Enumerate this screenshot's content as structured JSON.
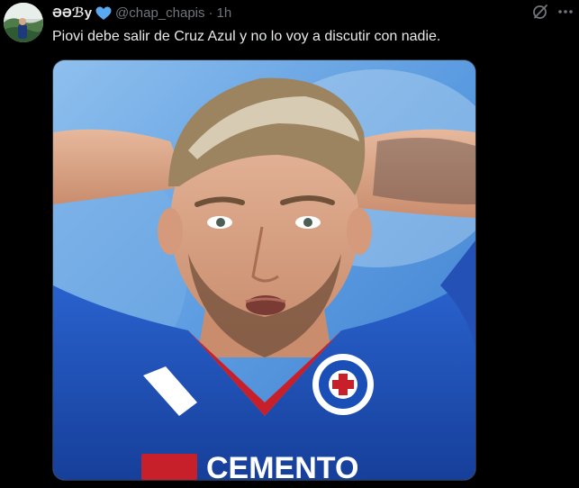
{
  "post": {
    "author": {
      "display_name": "ƏƏℬу",
      "handle": "@chap_chapis",
      "verified_icon": "blue-heart-icon"
    },
    "separator": "·",
    "time": "1h",
    "text": "Piovi debe salir de Cruz Azul y no lo voy a discutir con nadie.",
    "media": {
      "type": "photo",
      "jersey_sponsor": "CEMENTO",
      "colors": {
        "jersey_blue": "#1b4fb8",
        "collar_red": "#c8202a",
        "background_sky": "#5b9be0"
      }
    },
    "actions": {
      "grok_icon": "grok-icon",
      "more_icon": "more-icon"
    }
  }
}
